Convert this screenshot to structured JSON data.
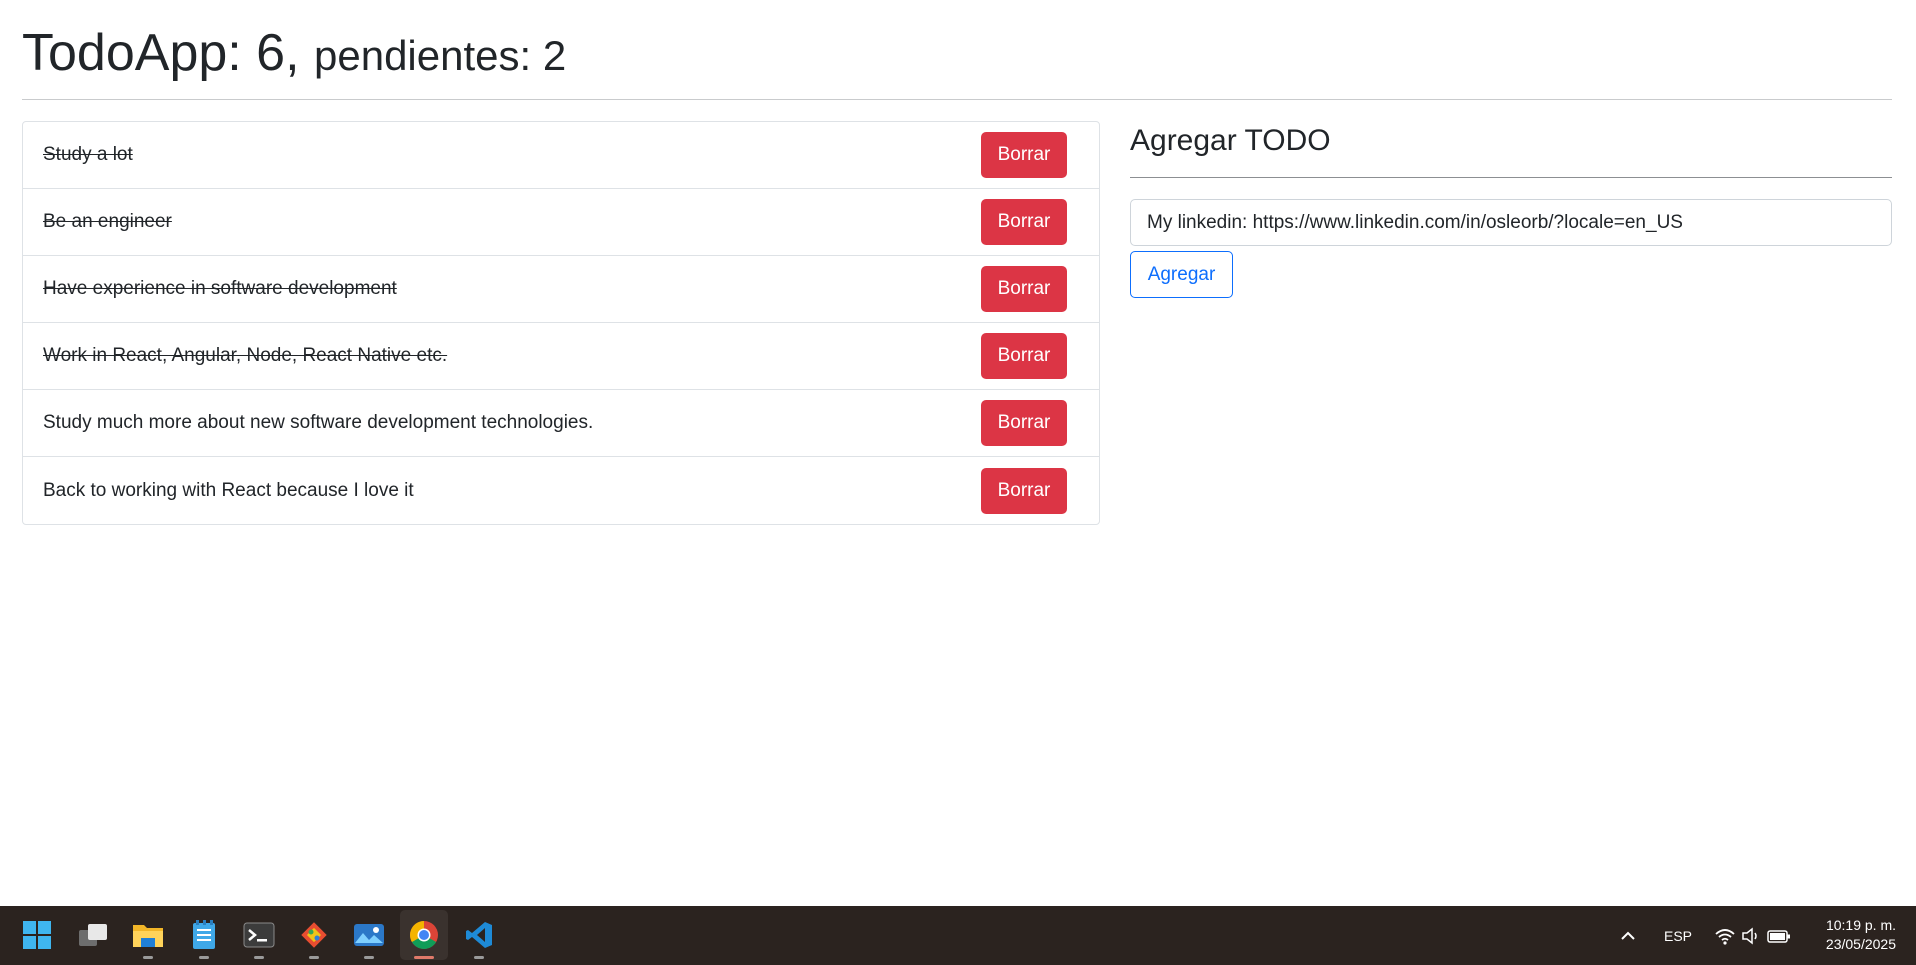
{
  "header": {
    "title_main": "TodoApp: 6, ",
    "title_sub": "pendientes: 2"
  },
  "todos": [
    {
      "text": "Study a lot",
      "done": true,
      "delete_label": "Borrar"
    },
    {
      "text": "Be an engineer",
      "done": true,
      "delete_label": "Borrar"
    },
    {
      "text": "Have experience in software development",
      "done": true,
      "delete_label": "Borrar"
    },
    {
      "text": "Work in React, Angular, Node, React Native etc.",
      "done": true,
      "delete_label": "Borrar"
    },
    {
      "text": "Study much more about new software development technologies.",
      "done": false,
      "delete_label": "Borrar"
    },
    {
      "text": "Back to working with React because I love it",
      "done": false,
      "delete_label": "Borrar"
    }
  ],
  "add_form": {
    "title": "Agregar TODO",
    "input_value": "My linkedin: https://www.linkedin.com/in/osleorb/?locale=en_US",
    "button_label": "Agregar"
  },
  "colors": {
    "danger": "#dc3545",
    "primary": "#0d6efd",
    "taskbar": "#2b231f"
  },
  "taskbar": {
    "apps": [
      {
        "name": "start-windows-icon",
        "active": false
      },
      {
        "name": "task-view-icon",
        "active": false
      },
      {
        "name": "file-explorer-icon",
        "active": false
      },
      {
        "name": "notepad-icon",
        "active": false
      },
      {
        "name": "terminal-icon",
        "active": false
      },
      {
        "name": "git-icon",
        "active": false
      },
      {
        "name": "photos-icon",
        "active": false
      },
      {
        "name": "chrome-icon",
        "active": true
      },
      {
        "name": "vscode-icon",
        "active": false
      }
    ],
    "language": "ESP",
    "time": "10:19 p. m.",
    "date": "23/05/2025"
  }
}
